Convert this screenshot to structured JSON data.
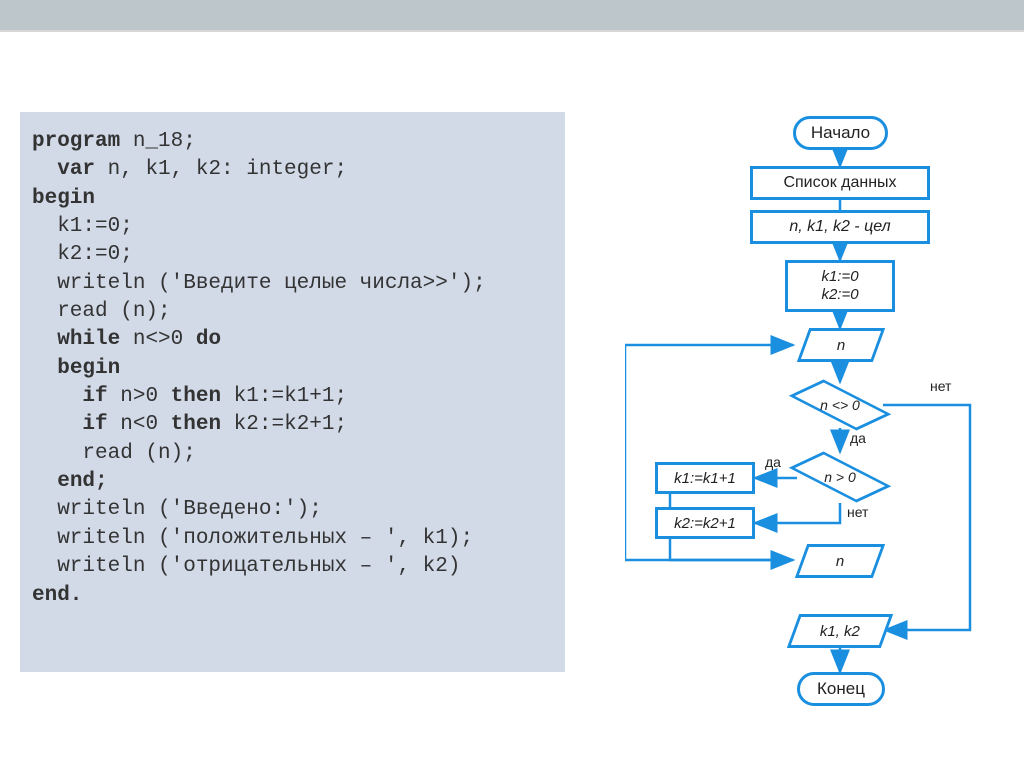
{
  "code": {
    "l1a": "program",
    "l1b": " n_18;",
    "l2a": "var",
    "l2b": " n, k1, k2: integer;",
    "l3": "begin",
    "l4": "  k1:=0;",
    "l5": "  k2:=0;",
    "l6": "  writeln ('Введите целые числа>>');",
    "l7": "  read (n);",
    "l8a": "while",
    "l8b": " n<>0 ",
    "l8c": "do",
    "l9": "begin",
    "l10a": "if",
    "l10b": " n>0 ",
    "l10c": "then",
    "l10d": " k1:=k1+1;",
    "l11a": "if",
    "l11b": " n<0 ",
    "l11c": "then",
    "l11d": " k2:=k2+1;",
    "l12": "    read (n);",
    "l13": "end;",
    "l14": "  writeln ('Введено:');",
    "l15": "  writeln ('положительных – ', k1);",
    "l16": "  writeln ('отрицательных – ', k2)",
    "l17": "end."
  },
  "flow": {
    "start": "Начало",
    "data_list": "Список данных",
    "vars": "n, k1, k2 - цел",
    "init": "k1:=0\nk2:=0",
    "input_n_1": "n",
    "cond1": "n <> 0",
    "cond2": "n > 0",
    "assign1": "k1:=k1+1",
    "assign2": "k2:=k2+1",
    "input_n_2": "n",
    "output": "k1, k2",
    "end": "Конец"
  },
  "labels": {
    "yes": "да",
    "no": "нет"
  }
}
